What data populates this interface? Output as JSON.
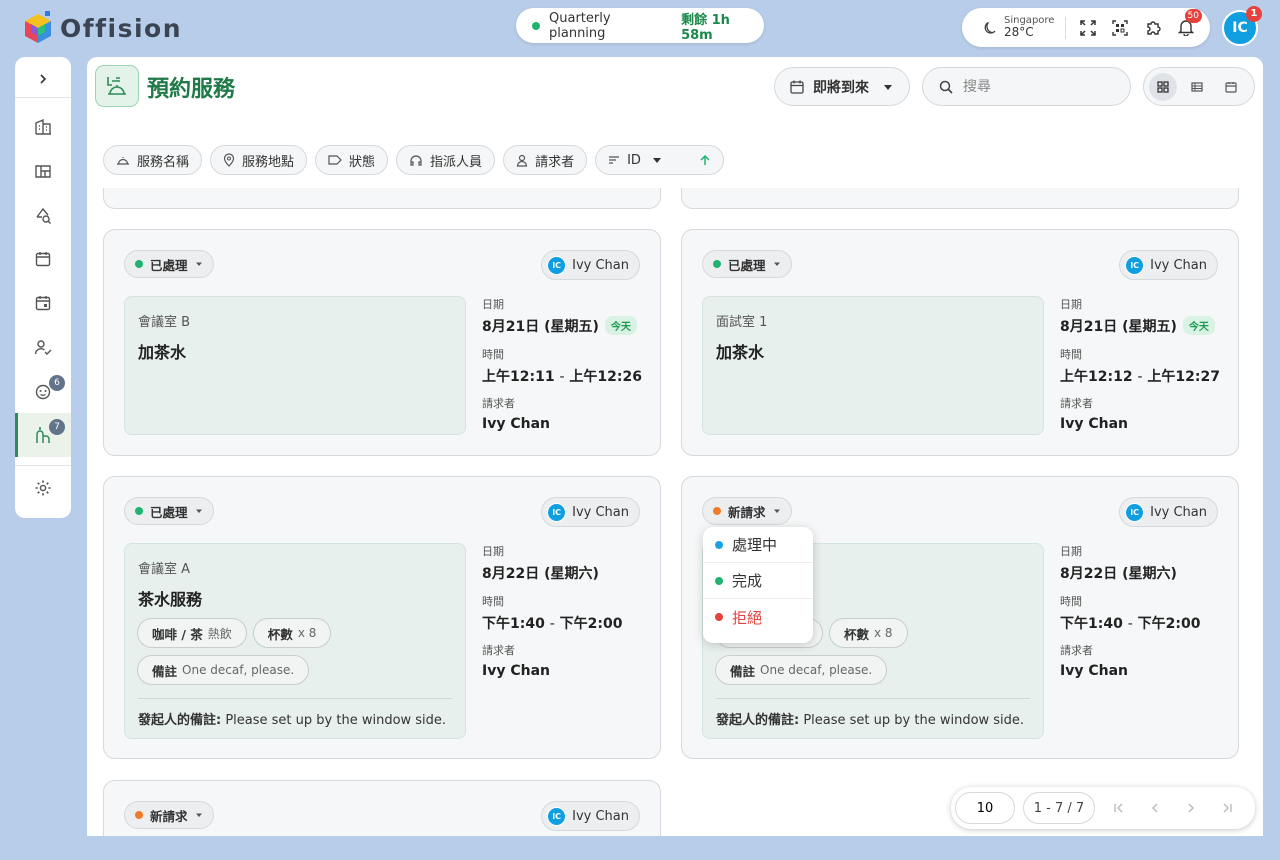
{
  "app": {
    "name": "Offision",
    "colors": {
      "accent": "#1f7a47",
      "brand_blue": "#0f9ee0",
      "background": "#b8cdea"
    }
  },
  "timer": {
    "label": "Quarterly planning",
    "remaining": "剩餘 1h 58m"
  },
  "topbar": {
    "weather_city": "Singapore",
    "weather_temp": "28°C",
    "notification_count": "50",
    "user_initials": "IC",
    "user_badge": "1",
    "icons": [
      "moon-icon",
      "fullscreen-icon",
      "qr-scan-icon",
      "puzzle-icon",
      "bell-icon"
    ]
  },
  "sidebar": {
    "badges": {
      "guests": "6",
      "services": "7"
    },
    "items": [
      "expand",
      "building",
      "floor-plan",
      "search-desk",
      "calendar",
      "calendar-event",
      "user-check",
      "guests",
      "services",
      "settings"
    ]
  },
  "page": {
    "title": "預約服務",
    "period_label": "即將到來",
    "search_placeholder": "搜尋"
  },
  "filters": {
    "service_name": "服務名稱",
    "location": "服務地點",
    "status": "狀態",
    "assignee": "指派人員",
    "requester": "請求者",
    "sort_field": "ID"
  },
  "labels": {
    "date": "日期",
    "time": "時間",
    "requester": "請求者",
    "today": "今天",
    "initiator_note": "發起人的備註:",
    "time_sep": "-"
  },
  "cards": [
    {
      "status": "已處理",
      "status_color": "#1fb56e",
      "assignee": "Ivy Chan",
      "assignee_initials": "IC",
      "location": "會議室 B",
      "service": "加茶水",
      "date": "8月21日 (星期五)",
      "start": "上午12:11",
      "end": "上午12:26",
      "requester": "Ivy Chan"
    },
    {
      "status": "已處理",
      "status_color": "#1fb56e",
      "assignee": "Ivy Chan",
      "assignee_initials": "IC",
      "location": "面試室 1",
      "service": "加茶水",
      "date": "8月21日 (星期五)",
      "start": "上午12:12",
      "end": "上午12:27",
      "requester": "Ivy Chan"
    },
    {
      "status": "已處理",
      "status_color": "#1fb56e",
      "assignee": "Ivy Chan",
      "assignee_initials": "IC",
      "location": "會議室 A",
      "service": "茶水服務",
      "opt1_label": "咖啡 / 茶",
      "opt1_value": "熱飲",
      "opt2_label": "杯數",
      "opt2_value": "x 8",
      "opt3_label": "備註",
      "opt3_value": "One decaf, please.",
      "note": "Please set up by the window side.",
      "date": "8月22日 (星期六)",
      "start": "下午1:40",
      "end": "下午2:00",
      "requester": "Ivy Chan"
    },
    {
      "status": "新請求",
      "status_color": "#f07b2a",
      "assignee": "Ivy Chan",
      "assignee_initials": "IC",
      "opt2_label": "杯數",
      "opt2_value": "x 8",
      "opt3_label": "備註",
      "opt3_value": "One decaf, please.",
      "note": "Please set up by the window side.",
      "date": "8月22日 (星期六)",
      "start": "下午1:40",
      "end": "下午2:00",
      "requester": "Ivy Chan"
    },
    {
      "status": "新請求",
      "status_color": "#f07b2a",
      "assignee": "Ivy Chan",
      "assignee_initials": "IC"
    }
  ],
  "status_menu": [
    {
      "label": "處理中",
      "color": "#1aa3e0"
    },
    {
      "label": "完成",
      "color": "#1fb56e"
    },
    {
      "label": "拒絕",
      "color": "#e5413d"
    }
  ],
  "pagination": {
    "page_size": "10",
    "range": "1 - 7 / 7"
  }
}
